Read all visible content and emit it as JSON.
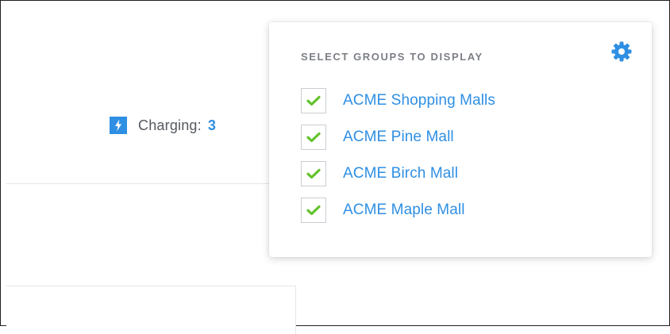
{
  "status": {
    "charging_label": "Charging:",
    "charging_count": "3"
  },
  "group_selector": {
    "title": "SELECT GROUPS TO DISPLAY",
    "settings_icon": "gear-icon",
    "check_icon": "check-icon",
    "groups": [
      {
        "label": "ACME Shopping Malls",
        "checked": true
      },
      {
        "label": "ACME Pine Mall",
        "checked": true
      },
      {
        "label": "ACME Birch Mall",
        "checked": true
      },
      {
        "label": "ACME Maple Mall",
        "checked": true
      }
    ]
  },
  "colors": {
    "accent_blue": "#2f8fe3",
    "check_green": "#63c22b",
    "title_gray": "#7b7f85",
    "text_gray": "#55595f"
  }
}
